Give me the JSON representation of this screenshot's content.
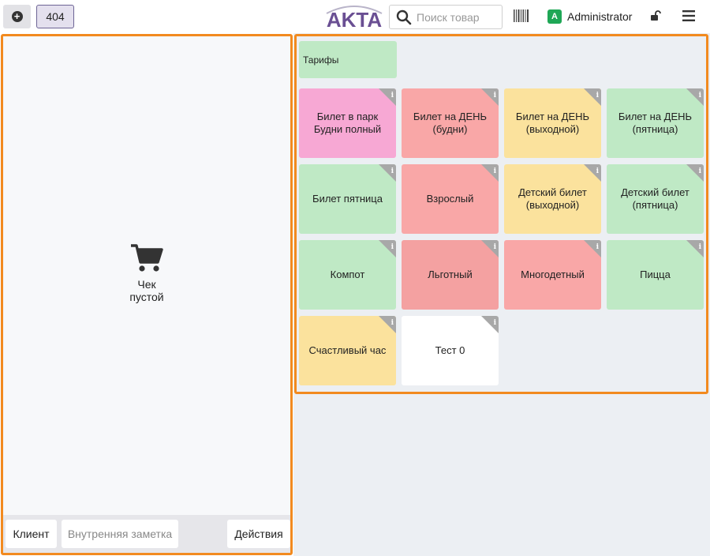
{
  "header": {
    "add_icon": "plus-circle-icon",
    "order_number": "404",
    "logo_text": "AKTA",
    "search_placeholder": "Поиск товар",
    "barcode_icon": "barcode-icon",
    "user": {
      "initial": "A",
      "name": "Administrator"
    },
    "lock_icon": "unlock-icon",
    "menu_icon": "hamburger-icon",
    "colors": {
      "logo": "#6a4f93",
      "avatar": "#1fa756"
    }
  },
  "cart": {
    "icon": "shopping-cart-icon",
    "empty_line1": "Чек",
    "empty_line2": "пустой",
    "footer": {
      "client_label": "Клиент",
      "note_label": "Внутренняя заметка",
      "actions_label": "Действия"
    }
  },
  "products": {
    "category_label": "Тарифы",
    "accent_border": "#f28a1f",
    "tiles": [
      {
        "label": "Билет в парк Будни полный",
        "color": "#f7a8d4"
      },
      {
        "label": "Билет на ДЕНЬ (будни)",
        "color": "#f9a7a7"
      },
      {
        "label": "Билет на ДЕНЬ (выходной)",
        "color": "#fbe29d"
      },
      {
        "label": "Билет на ДЕНЬ (пятница)",
        "color": "#bfe9c5"
      },
      {
        "label": "Билет пятница",
        "color": "#bfe9c5"
      },
      {
        "label": "Взрослый",
        "color": "#f9a7a7"
      },
      {
        "label": "Детский билет (выходной)",
        "color": "#fbe29d"
      },
      {
        "label": "Детский билет (пятница)",
        "color": "#bfe9c5"
      },
      {
        "label": "Компот",
        "color": "#bfe9c5"
      },
      {
        "label": "Льготный",
        "color": "#f4a1a1"
      },
      {
        "label": "Многодетный",
        "color": "#f9a7a7"
      },
      {
        "label": "Пицца",
        "color": "#bfe9c5"
      },
      {
        "label": "Счастливый час",
        "color": "#fbe29d"
      },
      {
        "label": "Тест 0",
        "color": "#ffffff"
      }
    ],
    "info_glyph": "i"
  }
}
